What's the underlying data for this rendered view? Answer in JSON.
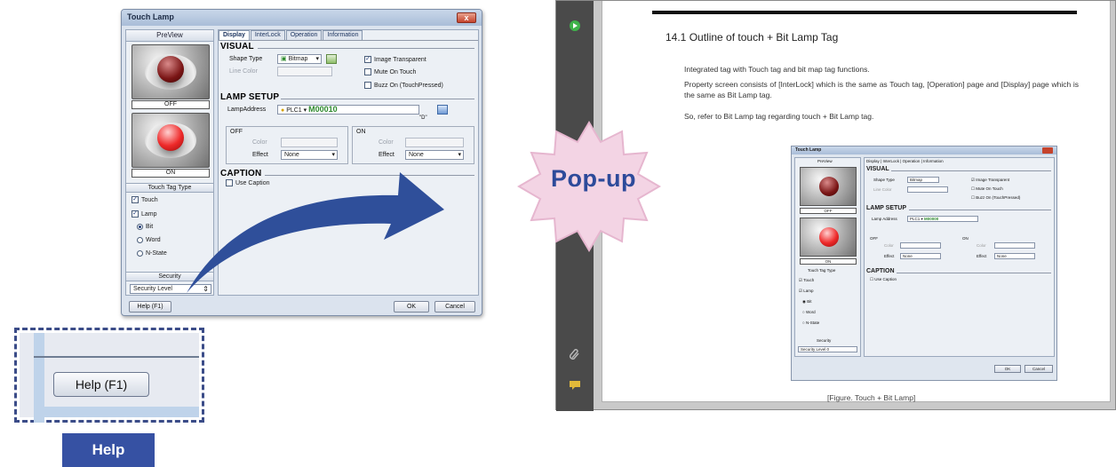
{
  "dialog": {
    "title": "Touch Lamp",
    "close_glyph": "x",
    "preview": {
      "header": "PreView",
      "off_label": "OFF",
      "on_label": "ON"
    },
    "touch_tag_type": {
      "header": "Touch Tag Type",
      "touch": "Touch",
      "lamp": "Lamp",
      "bit": "Bit",
      "word": "Word",
      "nstate": "N-State"
    },
    "security": {
      "header": "Security",
      "field": "Security Level",
      "spin_glyph": "⇕"
    },
    "tabs": [
      "Display",
      "InterLock",
      "Operation",
      "Information"
    ],
    "visual": {
      "title": "VISUAL",
      "shape_type_label": "Shape Type",
      "shape_type_value": "Bitmap",
      "line_color_label": "Line Color",
      "image_transparent": "Image Transparent",
      "mute_on_touch": "Mute On Touch",
      "buzz_on": "Buzz On (TouchPressed)"
    },
    "lamp_setup": {
      "title": "LAMP SETUP",
      "lamp_address_label": "LampAddress",
      "plc": "PLC1",
      "address": "M00010",
      "hint": "\"D\"",
      "off_group": "OFF",
      "on_group": "ON",
      "color_label": "Color",
      "effect_label": "Effect",
      "effect_value": "None"
    },
    "caption": {
      "title": "CAPTION",
      "use_caption": "Use Caption"
    },
    "buttons": {
      "help": "Help (F1)",
      "ok": "OK",
      "cancel": "Cancel"
    }
  },
  "zoom": {
    "help_button": "Help (F1)",
    "label": "Help"
  },
  "popup": {
    "badge": "Pop-up"
  },
  "document": {
    "heading": "14.1  Outline of touch + Bit Lamp Tag",
    "paragraphs": [
      "Integrated tag with Touch tag and bit map tag functions.",
      "Property screen consists of [InterLock] which is the same as Touch tag, [Operation] page and [Display] page which is the same as Bit Lamp tag.",
      "So, refer to Bit Lamp tag regarding touch + Bit Lamp tag."
    ],
    "figure_caption": "[Figure. Touch + Bit Lamp]",
    "mini": {
      "title": "Touch Lamp",
      "preview": "PreView",
      "tabs": [
        "Display",
        "InterLock",
        "Operation",
        "Information"
      ],
      "visual": "VISUAL",
      "shape_type": "Shape Type",
      "bitmap": "Bitmap",
      "line_color": "Line Color",
      "image_transparent": "Image Transparent",
      "mute_on_touch": "Mute On Touch",
      "buzz_on": "Buzz On (TouchPressed)",
      "lamp_setup": "LAMP SETUP",
      "lamp_address": "Lamp Address",
      "plc": "PLC1",
      "address": "M00000",
      "off": "OFF",
      "on": "ON",
      "color": "Color",
      "effect": "Effect",
      "none": "None",
      "caption": "CAPTION",
      "use_caption": "Use Caption",
      "touch_tag_type": "Touch Tag Type",
      "touch": "Touch",
      "lamp": "Lamp",
      "bit": "Bit",
      "word": "Word",
      "nstate": "N-State",
      "security": "Security",
      "security_level": "Security Level",
      "security_value": "0",
      "off_caption": "OFF",
      "on_caption": "ON",
      "ok": "OK",
      "cancel": "Cancel"
    }
  },
  "colors": {
    "accent_blue": "#3651a3",
    "arrow_blue": "#2f4f9a",
    "addr_green": "#2e8a2e",
    "badge_pink": "#f3d4e4"
  }
}
